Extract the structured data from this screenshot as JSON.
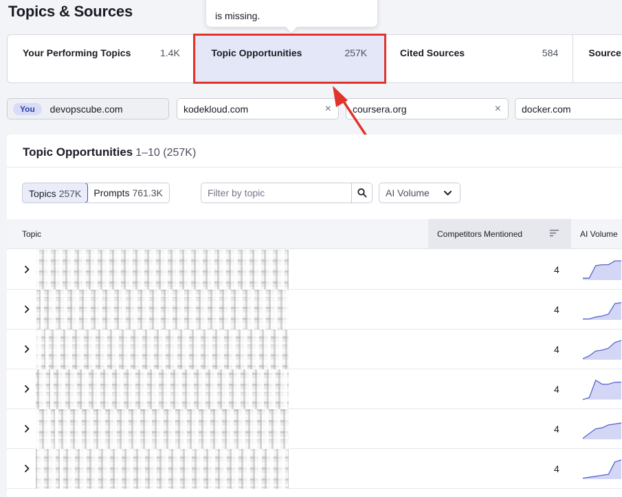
{
  "page_title": "Topics & Sources",
  "tooltip_text": "is missing.",
  "tabs": [
    {
      "label": "Your Performing Topics",
      "count": "1.4K"
    },
    {
      "label": "Topic Opportunities",
      "count": "257K"
    },
    {
      "label": "Cited Sources",
      "count": "584"
    },
    {
      "label": "Source"
    }
  ],
  "active_tab": "Topic Opportunities",
  "domains": {
    "you_badge": "You",
    "you": "devopscube.com",
    "competitors": [
      "kodekloud.com",
      "coursera.org",
      "docker.com"
    ],
    "remove_glyph": "×"
  },
  "panel": {
    "title": "Topic Opportunities",
    "range": "1–10 (257K)",
    "toggle": {
      "topics_label": "Topics",
      "topics_count": "257K",
      "prompts_label": "Prompts",
      "prompts_count": "761.3K"
    },
    "filter_placeholder": "Filter by topic",
    "volume_select": "AI Volume"
  },
  "table": {
    "columns": [
      "Topic",
      "Competitors Mentioned",
      "AI Volume"
    ],
    "sorted_column": "Competitors Mentioned",
    "rows": [
      {
        "competitors": "4",
        "trend": [
          0.1,
          0.1,
          0.75,
          0.8,
          0.8,
          1.0,
          1.0
        ]
      },
      {
        "competitors": "4",
        "trend": [
          0.05,
          0.05,
          0.15,
          0.2,
          0.3,
          0.85,
          0.9
        ]
      },
      {
        "competitors": "4",
        "trend": [
          0.05,
          0.2,
          0.45,
          0.5,
          0.6,
          0.9,
          1.0
        ]
      },
      {
        "competitors": "4",
        "trend": [
          0.0,
          0.1,
          1.0,
          0.8,
          0.8,
          0.9,
          0.9
        ]
      },
      {
        "competitors": "4",
        "trend": [
          0.05,
          0.3,
          0.55,
          0.6,
          0.75,
          0.8,
          0.85
        ]
      },
      {
        "competitors": "4",
        "trend": [
          0.05,
          0.1,
          0.15,
          0.2,
          0.25,
          0.9,
          1.0
        ]
      }
    ]
  },
  "colors": {
    "accent": "#3a4db8",
    "active_tab_bg": "#e4e7f7",
    "annotation_red": "#e0332b",
    "spark_fill": "#d3d6f5",
    "spark_stroke": "#5865c9"
  }
}
